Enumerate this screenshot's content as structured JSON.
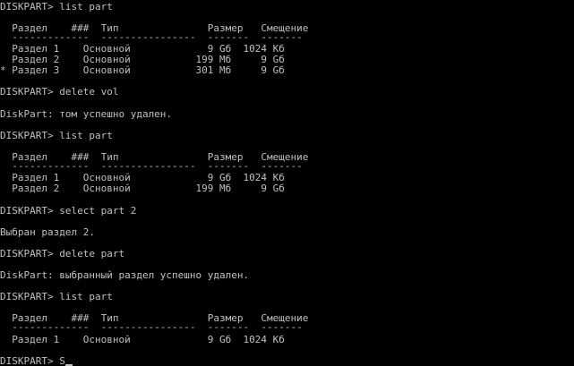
{
  "colors": {
    "background": "#000000",
    "text": "#c0c0c0"
  },
  "console": {
    "lines": [
      "DISKPART> list part",
      "  Раздел    ###  Тип               Размер   Смещение",
      "  -------------  ----------------  -------  -------",
      "  Раздел 1    Основной             9 Gб  1024 Кб",
      "  Раздел 2    Основной           199 Мб     9 Gб",
      "* Раздел 3    Основной           301 Мб     9 Gб",
      "DISKPART> delete vol",
      "DiskPart: том успешно удален.",
      "DISKPART> list part",
      "  Раздел    ###  Тип               Размер   Смещение",
      "  -------------  ----------------  -------  -------",
      "  Раздел 1    Основной             9 Gб  1024 Кб",
      "  Раздел 2    Основной           199 Мб     9 Gб",
      "DISKPART> select part 2",
      "Выбран раздел 2.",
      "DISKPART> delete part",
      "DiskPart: выбранный раздел успешно удален.",
      "DISKPART> list part",
      "  Раздел    ###  Тип               Размер   Смещение",
      "  -------------  ----------------  -------  -------",
      "  Раздел 1    Основной             9 Gб  1024 Кб"
    ],
    "prompt": "DISKPART> ",
    "input": "S"
  }
}
